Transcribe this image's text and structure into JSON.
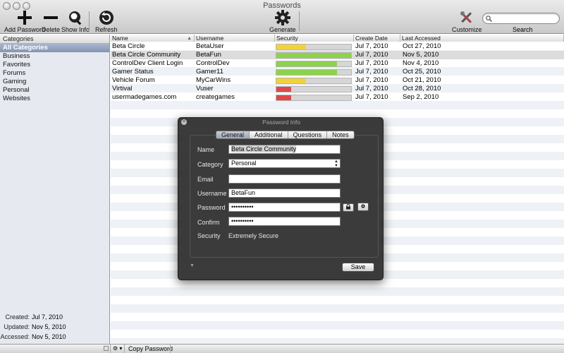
{
  "window": {
    "title": "Passwords"
  },
  "toolbar": {
    "add_label": "Add Password",
    "delete_label": "Delete",
    "show_info_label": "Show Info",
    "refresh_label": "Refresh",
    "generate_label": "Generate",
    "customize_label": "Customize",
    "search_label": "Search",
    "search_value": ""
  },
  "sidebar": {
    "header": "Categories",
    "items": [
      "All Categories",
      "Business",
      "Favorites",
      "Forums",
      "Gaming",
      "Personal",
      "Websites"
    ],
    "selected_index": 0,
    "info": {
      "created_label": "Created:",
      "created": "Jul 7, 2010",
      "updated_label": "Updated:",
      "updated": "Nov 5, 2010",
      "accessed_label": "Accessed:",
      "accessed": "Nov 5, 2010"
    }
  },
  "table": {
    "columns": [
      "Name",
      "Username",
      "Security",
      "Create Date",
      "Last Accessed"
    ],
    "sort_indicator": "▲",
    "selected_index": 1,
    "rows": [
      {
        "name": "Beta Circle",
        "username": "BetaUser",
        "security": 0.4,
        "created": "Jul 7, 2010",
        "accessed": "Oct 27, 2010"
      },
      {
        "name": "Beta Circle Community",
        "username": "BetaFun",
        "security": 1.0,
        "created": "Jul 7, 2010",
        "accessed": "Nov 5, 2010"
      },
      {
        "name": "ControlDev Client Login",
        "username": "ControlDev",
        "security": 0.81,
        "created": "Jul 7, 2010",
        "accessed": "Nov 4, 2010"
      },
      {
        "name": "Gamer Status",
        "username": "Gamer11",
        "security": 0.81,
        "created": "Jul 7, 2010",
        "accessed": "Oct 25, 2010"
      },
      {
        "name": "Vehicle Forum",
        "username": "MyCarWins",
        "security": 0.4,
        "created": "Jul 7, 2010",
        "accessed": "Oct 21, 2010"
      },
      {
        "name": "Virtival",
        "username": "Vuser",
        "security": 0.2,
        "created": "Jul 7, 2010",
        "accessed": "Oct 28, 2010"
      },
      {
        "name": "usermadegames.com",
        "username": "creategames",
        "security": 0.2,
        "created": "Jul 7, 2010",
        "accessed": "Sep 2, 2010"
      }
    ]
  },
  "colors": {
    "strong": "#8dd24b",
    "medium": "#f2d23c",
    "weak": "#e04848",
    "selection": "#dcdcdc"
  },
  "bottombar": {
    "gear_label": "⚙ ▾",
    "copy_label": "Copy Password"
  },
  "panel": {
    "title": "Password Info",
    "tabs": [
      "General",
      "Additional",
      "Questions",
      "Notes"
    ],
    "selected_tab": 0,
    "fields": {
      "name_label": "Name",
      "name": "Beta Circle Community",
      "category_label": "Category",
      "category": "Personal",
      "email_label": "Email",
      "email": "",
      "username_label": "Username",
      "username": "BetaFun",
      "password_label": "Password",
      "password": "••••••••••",
      "confirm_label": "Confirm",
      "confirm": "••••••••••",
      "security_label": "Security",
      "security": "Extremely Secure"
    },
    "save_label": "Save"
  }
}
